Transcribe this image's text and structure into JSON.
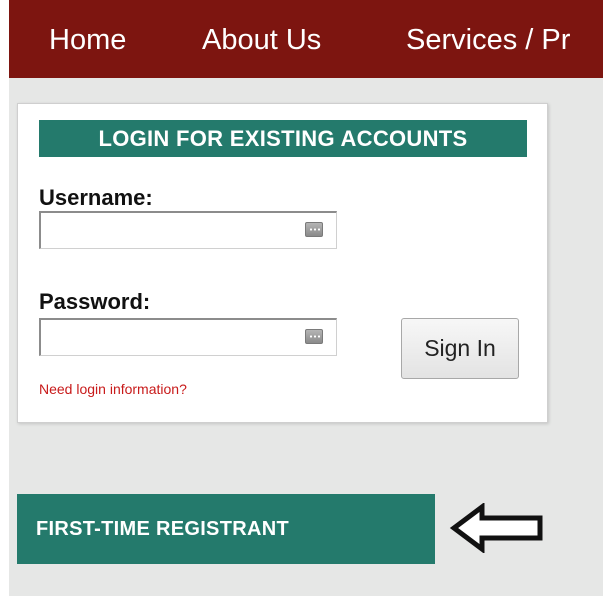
{
  "nav": {
    "items": [
      {
        "label": "Home"
      },
      {
        "label": "About Us"
      },
      {
        "label": "Services / Pr"
      }
    ]
  },
  "login": {
    "heading": "LOGIN FOR EXISTING ACCOUNTS",
    "username_label": "Username:",
    "username_value": "",
    "password_label": "Password:",
    "password_value": "",
    "signin_label": "Sign In",
    "help_link": "Need login information?",
    "field_icon": "password-manager-key-icon"
  },
  "register": {
    "label": "FIRST-TIME REGISTRANT"
  },
  "annotation": {
    "icon": "left-arrow-icon",
    "color": "#111111"
  },
  "colors": {
    "nav_background": "#7d1510",
    "accent": "#247a6c",
    "link": "#c81a1a",
    "page_background": "#e6e7e6"
  }
}
